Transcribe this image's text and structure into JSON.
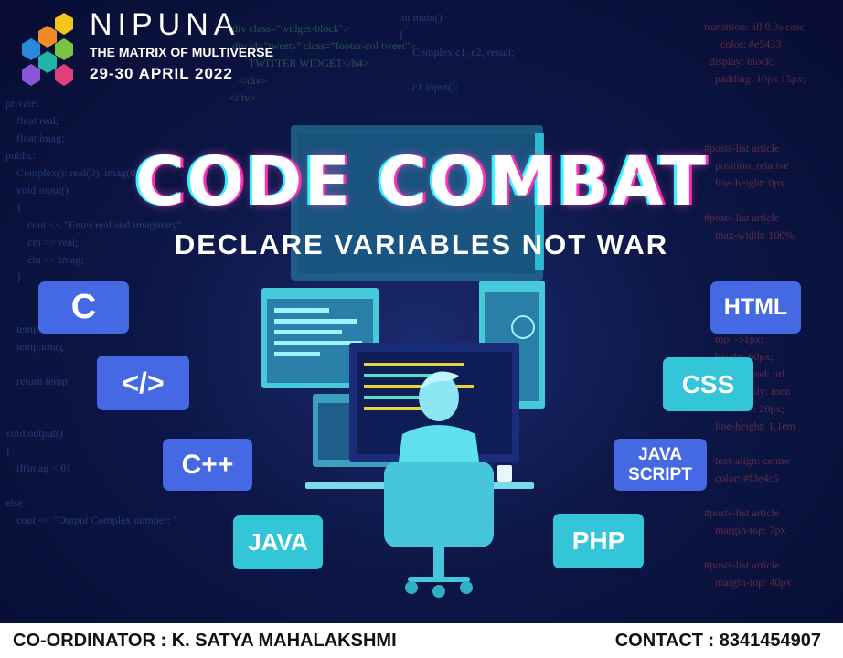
{
  "brand": {
    "name": "NIPUNA",
    "tagline": "THE MATRIX OF MULTIVERSE",
    "date": "29-30 APRIL 2022"
  },
  "headline": {
    "title": "CODE COMBAT",
    "subtitle": "DECLARE VARIABLES NOT WAR"
  },
  "languages": {
    "c": "C",
    "markup": "</>",
    "cpp": "C++",
    "java": "JAVA",
    "html": "HTML",
    "css": "CSS",
    "javascript": "JAVA SCRIPT",
    "php": "PHP"
  },
  "footer": {
    "coordinator": "CO-ORDINATOR : K. SATYA MAHALAKSHMI",
    "contact": "CONTACT : 8341454907"
  },
  "colors": {
    "background": "#0a1137",
    "button_blue": "#4469e2",
    "button_cyan": "#33c6d9",
    "glitch_pink": "#ff2fb0",
    "glitch_cyan": "#2ff5ff"
  }
}
